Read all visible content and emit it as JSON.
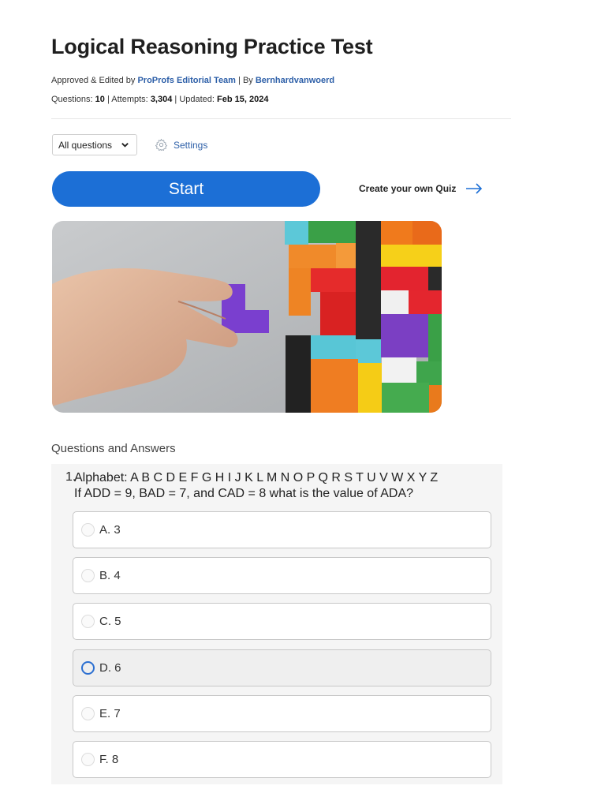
{
  "page": {
    "title": "Logical Reasoning Practice Test",
    "approved_prefix": "Approved & Edited by",
    "editorial_team": "ProProfs Editorial Team",
    "by_prefix": "| By",
    "author": "Bernhardvanwoerd",
    "questions_label": "Questions:",
    "questions_count": "10",
    "attempts_label": "| Attempts:",
    "attempts_count": "3,304",
    "updated_label": "| Updated:",
    "updated_date": "Feb 15, 2024"
  },
  "controls": {
    "select_value": "All questions",
    "settings_label": "Settings",
    "start_label": "Start",
    "create_quiz_label": "Create your own Quiz"
  },
  "hero_image": {
    "description": "hand-placing-tetromino-puzzle-icon"
  },
  "qa": {
    "heading": "Questions and Answers",
    "question": {
      "number": "1.",
      "line1": "Alphabet: A B C D E F G H I J K L M N O P Q R S T U V W X Y Z",
      "line2": "If ADD = 9, BAD = 7, and CAD = 8 what is the value of ADA?"
    },
    "options": [
      {
        "label": "A. 3",
        "state": "default"
      },
      {
        "label": "B. 4",
        "state": "default"
      },
      {
        "label": "C. 5",
        "state": "default"
      },
      {
        "label": "D. 6",
        "state": "hover"
      },
      {
        "label": "E. 7",
        "state": "default"
      },
      {
        "label": "F. 8",
        "state": "default"
      }
    ]
  },
  "colors": {
    "accent": "#1c6fd6",
    "link": "#2d5fa8"
  }
}
